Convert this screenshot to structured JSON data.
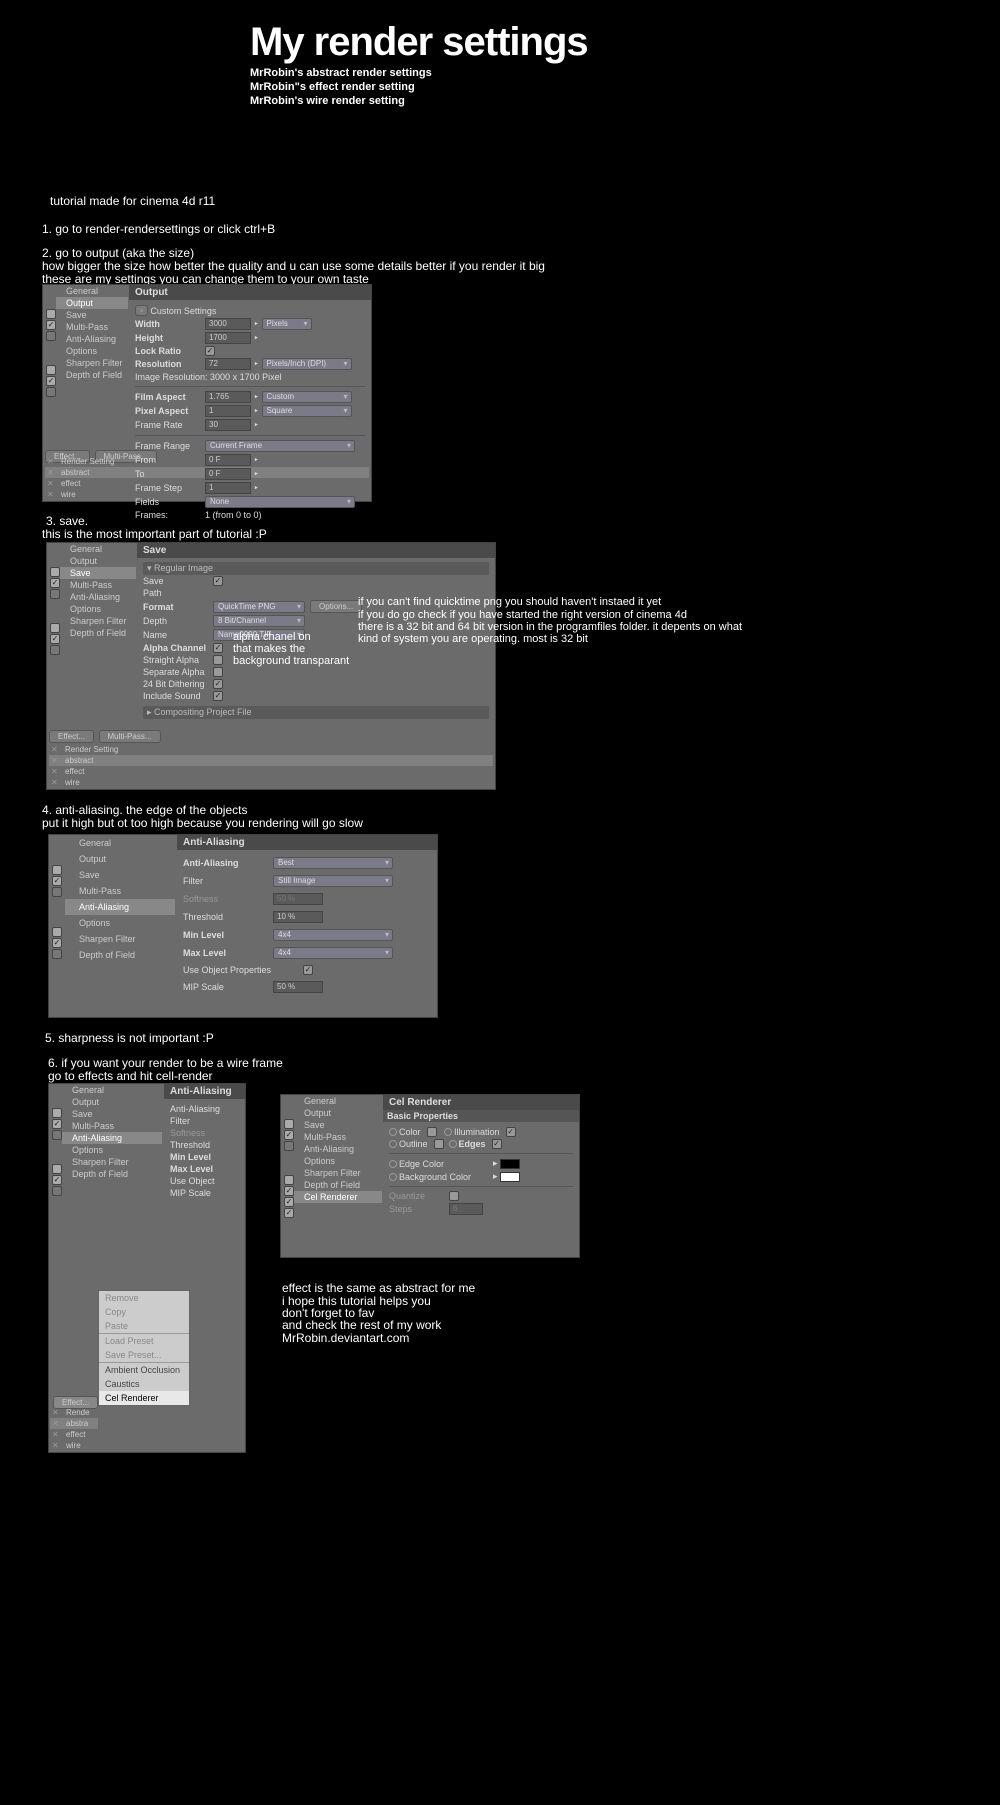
{
  "header": {
    "title": "My render settings",
    "subtitles": [
      "MrRobin's abstract render settings",
      "MrRobin\"s effect render setting",
      "MrRobin's wire render setting"
    ]
  },
  "intro": "tutorial made for cinema 4d r11",
  "steps": {
    "s1": "1. go to render-rendersettings or click ctrl+B",
    "s2a": "2. go to output (aka the size)",
    "s2b": "how bigger the size how better the quality and u can use some details better if you render it big",
    "s2c": "these are my settings you can change them to your own taste",
    "s3a": "3. save.",
    "s3b": "this is the most important part of tutorial :P",
    "s4a": "4. anti-aliasing. the edge of the objects",
    "s4b": "put it high but ot too high because you rendering will go slow",
    "s5": "5. sharpness is not important :P",
    "s6a": "6. if you want your render to be a wire frame",
    "s6b": "go to effects and hit cell-render"
  },
  "left_tree": {
    "items": [
      "General",
      "Output",
      "Save",
      "Multi-Pass",
      "Anti-Aliasing",
      "Options",
      "Sharpen Filter",
      "Depth of Field"
    ]
  },
  "panel1": {
    "title": "Output",
    "custom": "Custom Settings",
    "width_l": "Width",
    "width_v": "3000",
    "width_u": "Pixels",
    "height_l": "Height",
    "height_v": "1700",
    "lock_l": "Lock Ratio",
    "res_l": "Resolution",
    "res_v": "72",
    "res_u": "Pixels/Inch (DPI)",
    "imgres": "Image Resolution: 3000 x 1700 Pixel",
    "film_l": "Film Aspect",
    "film_v": "1.765",
    "film_u": "Custom",
    "pix_l": "Pixel Aspect",
    "pix_v": "1",
    "pix_u": "Square",
    "fps_l": "Frame Rate",
    "fps_v": "30",
    "frange_l": "Frame Range",
    "frange_v": "Current Frame",
    "from_l": "From",
    "from_v": "0 F",
    "to_l": "To",
    "to_v": "0 F",
    "fstep_l": "Frame Step",
    "fstep_v": "1",
    "fields_l": "Fields",
    "fields_v": "None",
    "frames_l": "Frames:",
    "frames_v": "1 (from 0 to 0)",
    "effect_btn": "Effect...",
    "multipass_btn": "Multi-Pass...",
    "presets": [
      "Render Setting",
      "abstract",
      "effect",
      "wire"
    ]
  },
  "panel2": {
    "title": "Save",
    "section": "▾ Regular Image",
    "save_l": "Save",
    "path_l": "Path",
    "format_l": "Format",
    "format_v": "QuickTime PNG",
    "options_btn": "Options...",
    "depth_l": "Depth",
    "depth_v": "8 Bit/Channel",
    "name_l": "Name",
    "name_v": "Name0000.TIF",
    "alpha_l": "Alpha Channel",
    "straight_l": "Straight Alpha",
    "separate_l": "Separate Alpha",
    "dither_l": "24 Bit Dithering",
    "sound_l": "Include Sound",
    "comp_section": "▸ Compositing Project File"
  },
  "panel2_annot": {
    "a1": "alpha chanel on",
    "a2": "that makes the",
    "a3": "background transparant",
    "b1": "if you can't find quicktime png you should haven't instaed it yet",
    "b2": "if you do go check if you have started the right version of cinema 4d",
    "b3": "there is a 32 bit and 64 bit version in the programfiles folder. it depents on what",
    "b4": "kind of system you are operating. most is 32 bit"
  },
  "panel3": {
    "title": "Anti-Aliasing",
    "aa_l": "Anti-Aliasing",
    "aa_v": "Best",
    "filter_l": "Filter",
    "filter_v": "Still Image",
    "soft_l": "Softness",
    "soft_v": "50 %",
    "thresh_l": "Threshold",
    "thresh_v": "10 %",
    "min_l": "Min Level",
    "min_v": "4x4",
    "max_l": "Max Level",
    "max_v": "4x4",
    "obj_l": "Use Object Properties",
    "mip_l": "MIP Scale",
    "mip_v": "50 %"
  },
  "panel4_left": {
    "title": "Anti-Aliasing",
    "aa_l": "Anti-Aliasing",
    "filter_l": "Filter",
    "soft_l": "Softness",
    "thresh_l": "Threshold",
    "min_l": "Min Level",
    "max_l": "Max Level",
    "obj_l": "Use Object",
    "mip_l": "MIP Scale"
  },
  "ctx_menu": {
    "items": [
      "Remove",
      "Copy",
      "Paste",
      "Load Preset",
      "Save Preset...",
      "Ambient Occlusion",
      "Caustics",
      "Cel Renderer"
    ]
  },
  "panel4_presets_short": [
    "Rende",
    "abstra",
    "effect",
    "wire"
  ],
  "panel5_tree_extra": "Cel Renderer",
  "panel5": {
    "title": "Cel Renderer",
    "section": "Basic Properties",
    "color_l": "Color",
    "illum_l": "Illumination",
    "outline_l": "Outline",
    "edges_l": "Edges",
    "edge_color_l": "Edge Color",
    "bg_color_l": "Background Color",
    "quantize_l": "Quantize",
    "steps_l": "Steps",
    "steps_v": "6"
  },
  "closing": {
    "l1": "effect is the same as abstract for me",
    "l2": "i hope this tutorial helps you",
    "l3": "don't forget to fav",
    "l4": "and check the rest of my work",
    "l5": "MrRobin.deviantart.com"
  }
}
